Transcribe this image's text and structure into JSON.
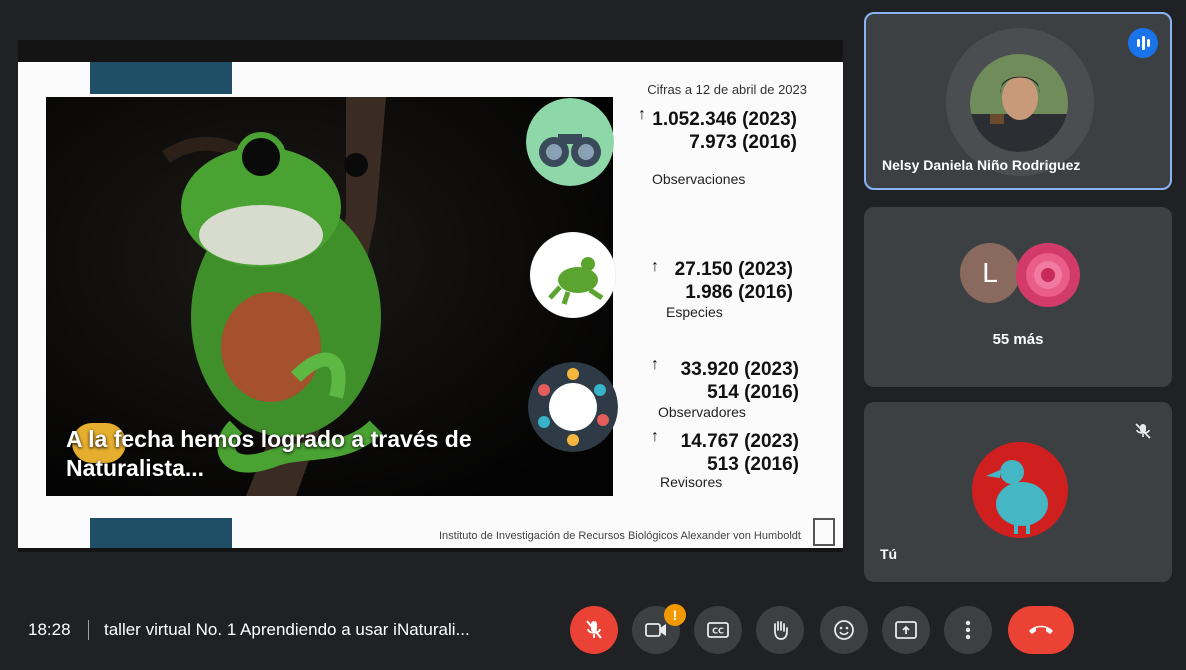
{
  "slide": {
    "date_note": "Cifras a 12 de abril de 2023",
    "caption": "A la fecha hemos logrado a través de Naturalista...",
    "stats": [
      {
        "current": "1.052.346 (2023)",
        "previous": "7.973 (2016)",
        "label": "Observaciones",
        "icon": "binoculars-icon"
      },
      {
        "current": "27.150 (2023)",
        "previous": "1.986 (2016)",
        "label": "Especies",
        "icon": "frog-icon"
      },
      {
        "current": "33.920 (2023)",
        "previous": "514 (2016)",
        "label": "Observadores",
        "icon": "people-circle-icon"
      },
      {
        "current": "14.767 (2023)",
        "previous": "513 (2016)",
        "label": "Revisores",
        "icon": "none"
      }
    ],
    "arrow_glyph": "↑",
    "footer": "Instituto de Investigación de Recursos Biológicos Alexander von Humboldt"
  },
  "participants": {
    "speaker": {
      "name": "Nelsy Daniela Niño Rodriguez"
    },
    "group": {
      "avatar_letter": "L",
      "more": "55 más"
    },
    "self": {
      "name": "Tú"
    }
  },
  "toolbar": {
    "time": "18:28",
    "meeting_title": "taller virtual No. 1 Aprendiendo a usar iNaturali...",
    "camera_warning": "!"
  },
  "colors": {
    "accent_blue": "#1a73e8",
    "end_call_red": "#ea4335",
    "slide_bar": "#1e4f66",
    "warning_orange": "#f29900"
  }
}
